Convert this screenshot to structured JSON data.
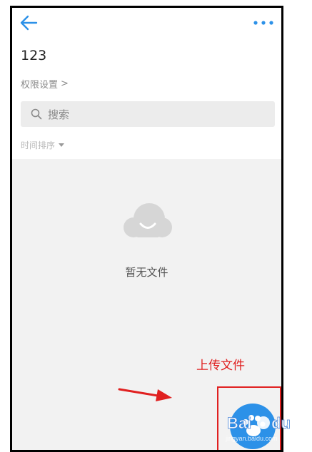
{
  "header": {
    "back_icon": "arrow-left-icon",
    "more_icon": "ellipsis-icon",
    "accent_color": "#2c91e8"
  },
  "folder": {
    "title": "123",
    "permission_label": "权限设置",
    "permission_chevron": ">"
  },
  "search": {
    "placeholder": "搜索",
    "icon": "search-icon"
  },
  "sort": {
    "label": "时间排序",
    "icon": "caret-down-icon"
  },
  "empty_state": {
    "icon": "cloud-smile-icon",
    "text": "暂无文件"
  },
  "annotation": {
    "label": "上传文件",
    "color": "#e02020"
  },
  "upload_button": {
    "icon": "baidu-paw-icon",
    "color": "#2c91e8"
  },
  "watermark": {
    "brand": "Baidu 经验",
    "url": "jingyan.baidu.com"
  }
}
